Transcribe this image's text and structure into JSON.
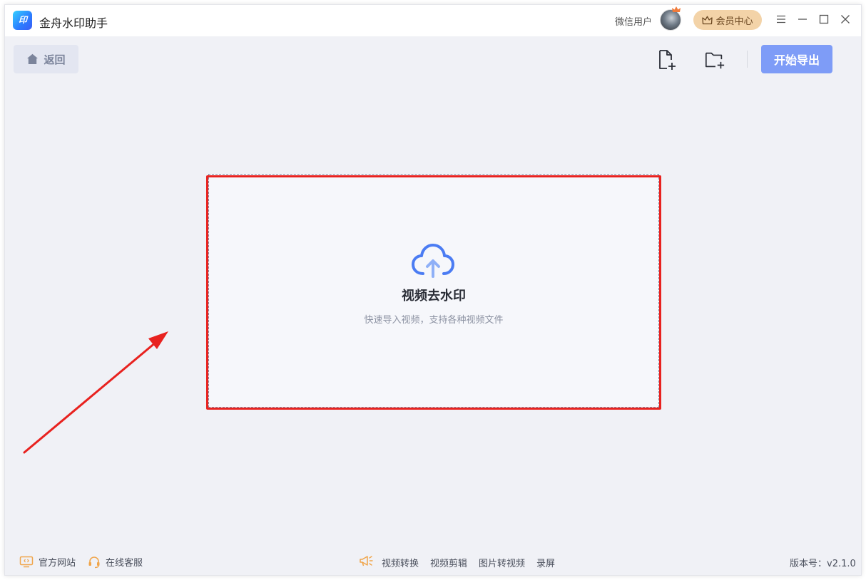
{
  "titlebar": {
    "logo_text": "印",
    "app_title": "金舟水印助手",
    "user_name": "微信用户",
    "vip_label": "会员中心"
  },
  "toolbar": {
    "back_label": "返回",
    "export_label": "开始导出",
    "add_file_icon": "file-add-icon",
    "add_folder_icon": "folder-add-icon"
  },
  "dropzone": {
    "title": "视频去水印",
    "subtitle": "快速导入视频，支持各种视频文件",
    "icon": "cloud-upload-icon"
  },
  "footer": {
    "official_site": "官方网站",
    "online_service": "在线客服",
    "tools": [
      "视频转换",
      "视频剪辑",
      "图片转视频",
      "录屏"
    ],
    "version": "版本号：v2.1.0"
  },
  "colors": {
    "accent": "#7e9cf7",
    "upload_icon": "#4b7cf3",
    "highlight": "#e8221f",
    "vip_bg": "#f3d3a8",
    "footer_icon": "#f0a54a"
  }
}
